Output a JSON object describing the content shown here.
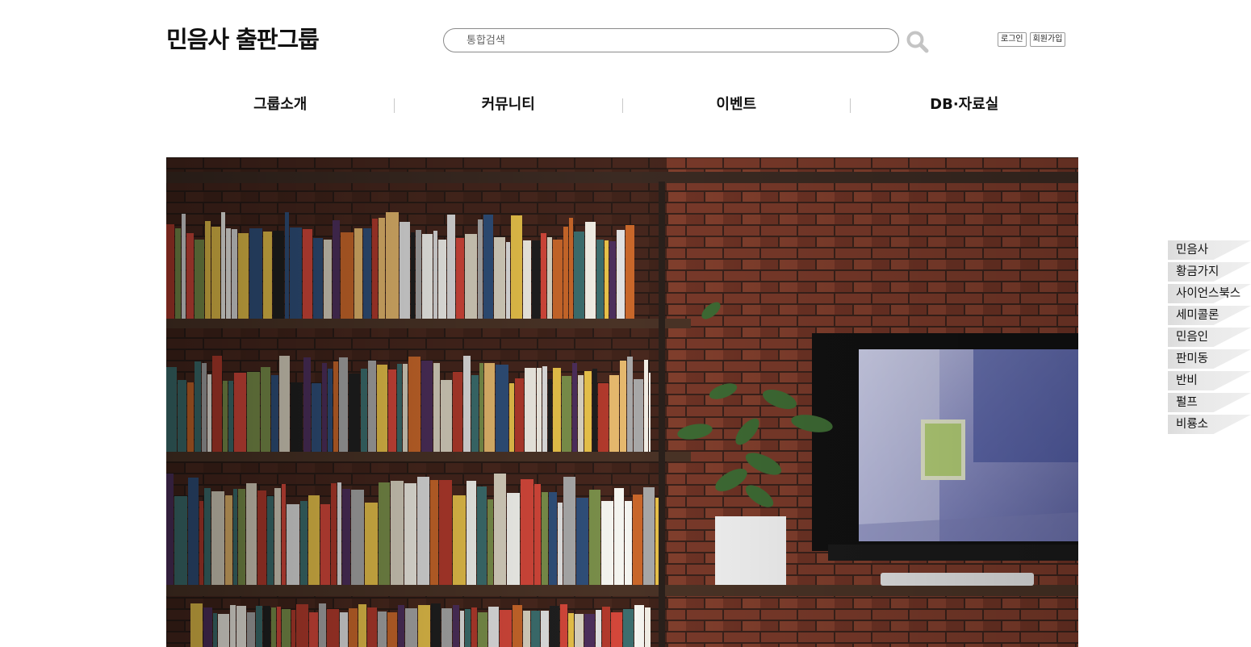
{
  "header": {
    "logo": "민음사 출판그룹",
    "search_placeholder": "통합검색",
    "login": "로그인",
    "signup": "회원가입"
  },
  "nav": {
    "items": [
      "그룹소개",
      "커뮤니티",
      "이벤트",
      "DB·자료실"
    ]
  },
  "side_menu": {
    "items": [
      "민음사",
      "황금가지",
      "사이언스북스",
      "세미콜론",
      "민음인",
      "판미동",
      "반비",
      "펄프",
      "비룡소"
    ]
  },
  "hero": {
    "image": "bookshelf-with-monitor-photo"
  },
  "colors": {
    "text": "#111111",
    "border": "#8a8a8a",
    "search_icon": "#c4c4c4",
    "side_bg": "#e6e6e6"
  }
}
